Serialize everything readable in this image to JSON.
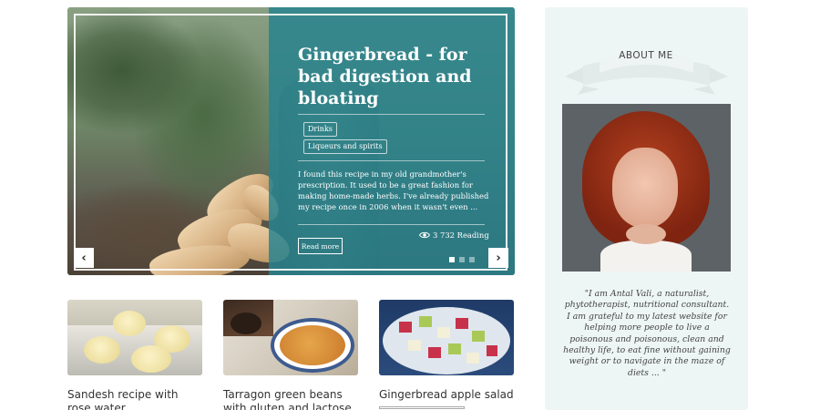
{
  "slider": {
    "title": "Gingerbread - for bad digestion and bloating",
    "tags": [
      "Drinks",
      "Liqueurs and spirits"
    ],
    "excerpt": "I found this recipe in my old grandmother's prescription. It used to be a great fashion for making home-made herbs. I've already published my recipe once in 2006 when it wasn't even ...",
    "views": "3 732 Reading",
    "read_more": "Read more",
    "prev_icon": "chevron-left-icon",
    "next_icon": "chevron-right-icon",
    "pages": 3,
    "active_page": 1,
    "accent_color": "#27838f"
  },
  "cards": [
    {
      "title": "Sandesh recipe with rose water"
    },
    {
      "title": "Tarragon green beans with gluten and lactose"
    },
    {
      "title": "Gingerbread apple salad"
    }
  ],
  "sidebar": {
    "about_title": "ABOUT ME",
    "about_text": "\"I am Antal Vali, a naturalist, phytotherapist, nutritional consultant. I am grateful to my latest website for helping more people to live a poisonous and poisonous, clean and healthy life, to eat fine without gaining weight or to navigate in the maze of diets ... \""
  }
}
